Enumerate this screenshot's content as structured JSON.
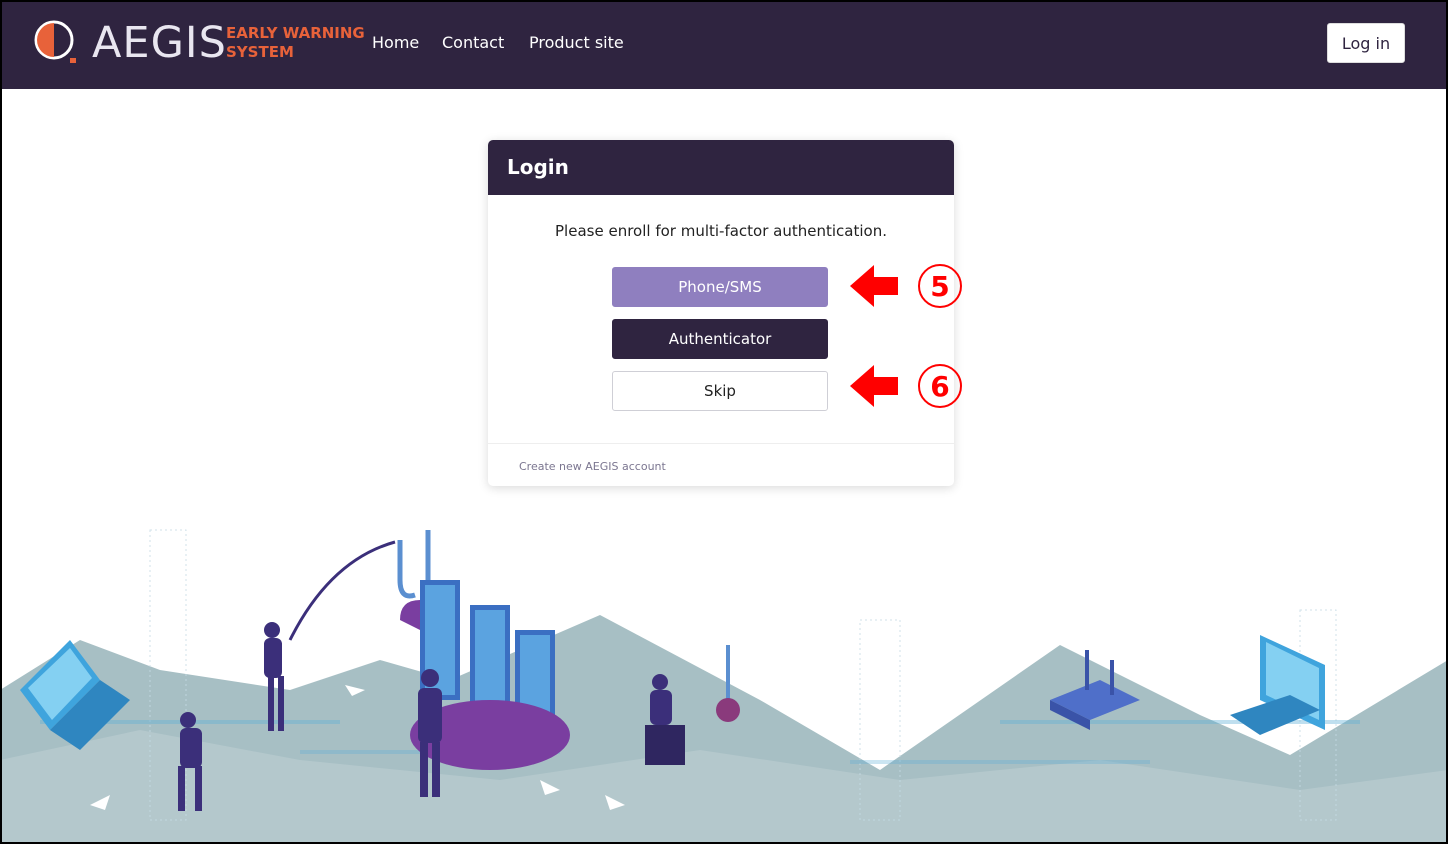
{
  "header": {
    "brand": "AEGIS",
    "tagline_line1": "EARLY WARNING",
    "tagline_line2": "SYSTEM",
    "nav": [
      {
        "label": "Home"
      },
      {
        "label": "Contact"
      },
      {
        "label": "Product site"
      }
    ],
    "login_label": "Log in"
  },
  "card": {
    "title": "Login",
    "prompt": "Please enroll for multi-factor authentication.",
    "buttons": {
      "phone": "Phone/SMS",
      "authenticator": "Authenticator",
      "skip": "Skip"
    },
    "footer_link": "Create new AEGIS account"
  },
  "annotations": [
    {
      "number": "5",
      "icon": "left-arrow-icon",
      "color": "#ff0000"
    },
    {
      "number": "6",
      "icon": "left-arrow-icon",
      "color": "#ff0000"
    }
  ],
  "colors": {
    "header_bg": "#2f2440",
    "brand_accent": "#e8623a",
    "phone_button": "#8f7fbf",
    "annotation": "#ff0000"
  }
}
